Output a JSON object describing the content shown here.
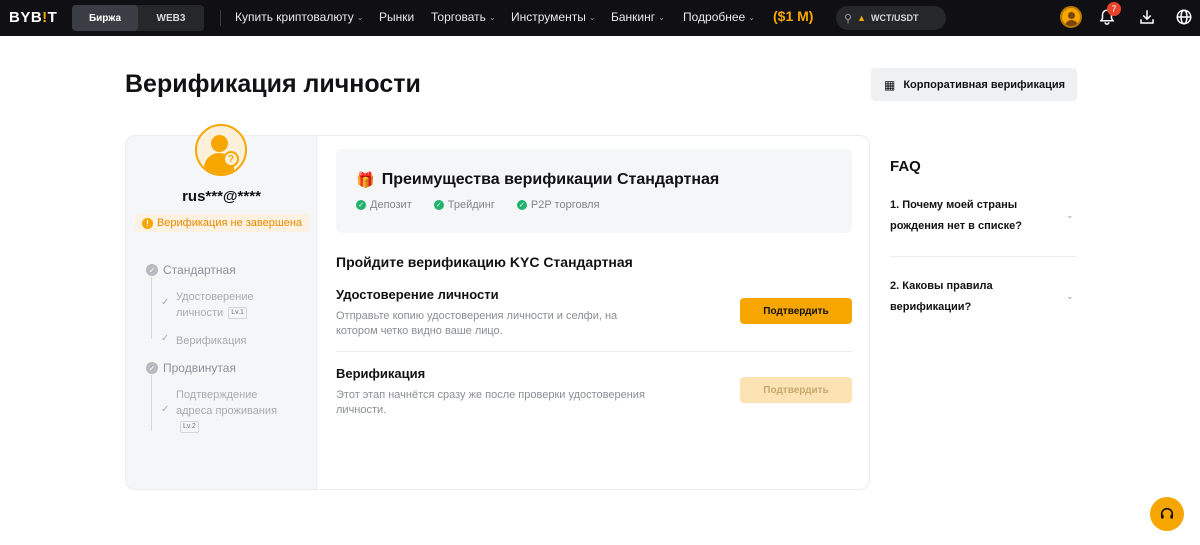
{
  "nav": {
    "logo_left": "BYB",
    "logo_bar": "!",
    "logo_right": "T",
    "segments": [
      "Биржа",
      "WEB3"
    ],
    "items": [
      {
        "label": "Купить криптовалюту",
        "has_menu": true
      },
      {
        "label": "Рынки",
        "has_menu": false
      },
      {
        "label": "Торговать",
        "has_menu": true
      },
      {
        "label": "Инструменты",
        "has_menu": true
      },
      {
        "label": "Банкинг",
        "has_menu": true
      },
      {
        "label": "Подробнее",
        "has_menu": true
      }
    ],
    "promo": "($1 M)",
    "search_value": "WCT/USDT",
    "notifications_count": "7",
    "accent": "#f7a600"
  },
  "page": {
    "title": "Верификация личности",
    "corporate_button": "Корпоративная верификация"
  },
  "profile": {
    "email": "rus***@****",
    "status": "Верификация не завершена"
  },
  "levels": {
    "standard": {
      "label": "Стандартная",
      "sub1_line1": "Удостоверение",
      "sub1_line2": "личности",
      "sub1_badge": "Lv.1",
      "sub2": "Верификация"
    },
    "advanced": {
      "label": "Продвинутая",
      "sub1_line1": "Подтверждение",
      "sub1_line2": "адреса проживания",
      "sub1_badge": "Lv.2"
    }
  },
  "benefits": {
    "title": "Преимущества верификации Стандартная",
    "items": [
      "Депозит",
      "Трейдинг",
      "P2P торговля"
    ]
  },
  "kyc": {
    "title": "Пройдите верификацию KYC Стандартная",
    "steps": [
      {
        "title": "Удостоверение личности",
        "desc_line1": "Отправьте копию удостоверения личности и селфи, на",
        "desc_line2": "котором четко видно ваше лицо.",
        "button": "Подтвердить",
        "enabled": true
      },
      {
        "title": "Верификация",
        "desc_line1": "Этот этап начнётся сразу же после проверки удостоверения",
        "desc_line2": "личности.",
        "button": "Подтвердить",
        "enabled": false
      }
    ]
  },
  "faq": {
    "title": "FAQ",
    "items": [
      {
        "line1": "1. Почему моей страны",
        "line2": "рождения нет в списке?"
      },
      {
        "line1": "2. Каковы правила",
        "line2": "верификации?"
      }
    ]
  }
}
